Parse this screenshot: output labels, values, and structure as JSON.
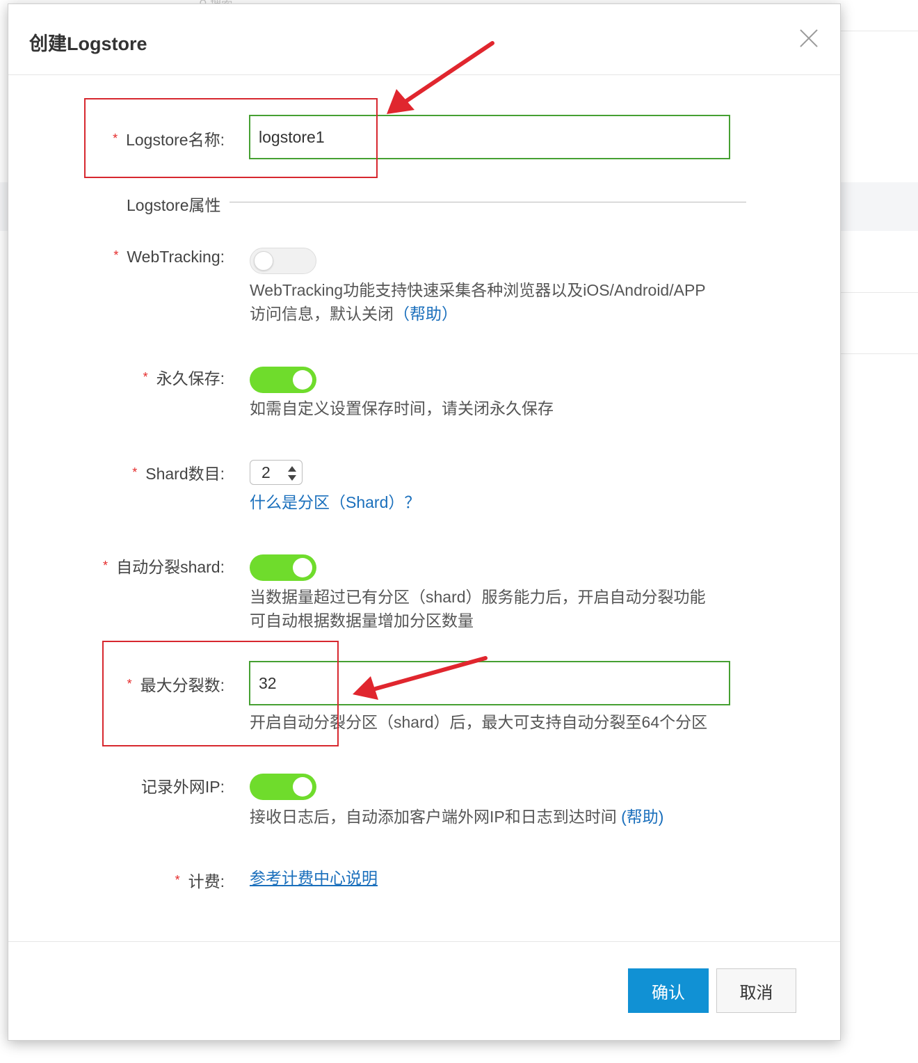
{
  "background": {
    "search_label": "搜索"
  },
  "dialog": {
    "title": "创建Logstore",
    "fields": {
      "logstore_name": {
        "label": "Logstore名称:",
        "value": "logstore1"
      },
      "section_title": "Logstore属性",
      "webtracking": {
        "label": "WebTracking:",
        "enabled": false,
        "help_line1": "WebTracking功能支持快速采集各种浏览器以及iOS/Android/APP",
        "help_line2": "访问信息，默认关闭",
        "help_link": "（帮助）"
      },
      "permanent": {
        "label": "永久保存:",
        "enabled": true,
        "help": "如需自定义设置保存时间，请关闭永久保存"
      },
      "shard_count": {
        "label": "Shard数目:",
        "value": "2",
        "help_link": "什么是分区（Shard）？"
      },
      "auto_split": {
        "label": "自动分裂shard:",
        "enabled": true,
        "help_line1": "当数据量超过已有分区（shard）服务能力后，开启自动分裂功能",
        "help_line2": "可自动根据数据量增加分区数量"
      },
      "max_split": {
        "label": "最大分裂数:",
        "value": "32",
        "help": "开启自动分裂分区（shard）后，最大可支持自动分裂至64个分区"
      },
      "record_ip": {
        "label": "记录外网IP:",
        "enabled": true,
        "help": "接收日志后，自动添加客户端外网IP和日志到达时间 ",
        "help_link": "(帮助)"
      },
      "billing": {
        "label": "计费:",
        "link": "参考计费中心说明"
      }
    },
    "buttons": {
      "confirm": "确认",
      "cancel": "取消"
    }
  },
  "annotation_colors": {
    "box": "#d7282f",
    "input_focus": "#46a032",
    "primary": "#1191d4",
    "toggle_on": "#6fdc2c"
  }
}
